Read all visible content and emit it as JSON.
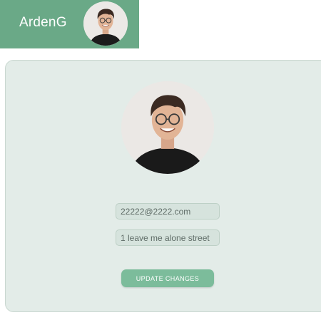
{
  "header": {
    "username": "ArdenG",
    "avatar_icon": "user-photo"
  },
  "profile": {
    "avatar_icon": "user-photo",
    "email_value": "22222@2222.com",
    "address_value": "1 leave me alone street",
    "update_button_label": "UPDATE CHANGES"
  },
  "colors": {
    "header_bg": "#6aa987",
    "card_bg": "#e3ece8",
    "button_bg": "#7cbc9b",
    "field_bg": "#d6e3dd"
  }
}
